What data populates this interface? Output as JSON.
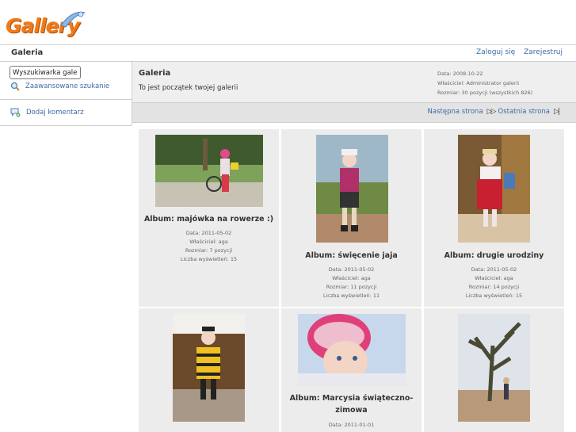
{
  "header": {
    "logo_text": "Gallery",
    "breadcrumb": "Galeria",
    "login_label": "Zaloguj się",
    "register_label": "Zarejestruj"
  },
  "sidebar": {
    "search_value": "Wyszukiwarka galerii",
    "advanced_search_label": "Zaawansowane szukanie",
    "add_comment_label": "Dodaj komentarz"
  },
  "album": {
    "title": "Galeria",
    "description": "To jest początek twojej galerii",
    "meta": [
      "Data: 2008-10-22",
      "Właściciel: Administrator galerii",
      "Rozmiar: 30 pozycji (wszystkich 826)"
    ]
  },
  "pager": {
    "next_label": "Następna strona",
    "last_label": "Ostatnia strona"
  },
  "items": [
    {
      "title": "Album: majówka na rowerze :)",
      "meta": [
        "Data: 2011-05-02",
        "Właściciel: aga",
        "Rozmiar: 7 pozycji",
        "Liczba wyświetleń: 15"
      ]
    },
    {
      "title": "Album: święcenie jaja",
      "meta": [
        "Data: 2011-05-02",
        "Właściciel: aga",
        "Rozmiar: 11 pozycji",
        "Liczba wyświetleń: 11"
      ]
    },
    {
      "title": "Album: drugie urodziny",
      "meta": [
        "Data: 2011-05-02",
        "Właściciel: aga",
        "Rozmiar: 14 pozycji",
        "Liczba wyświetleń: 15"
      ]
    },
    {
      "title": "",
      "meta": []
    },
    {
      "title": "Album: Marcysia świąteczno-zimowa",
      "meta": [
        "Data: 2011-01-01"
      ]
    },
    {
      "title": "",
      "meta": []
    }
  ],
  "colors": {
    "link": "#3a6aa8",
    "logo_orange": "#f07a1a",
    "panel_bg": "#efefef",
    "cell_bg": "#ececec"
  }
}
